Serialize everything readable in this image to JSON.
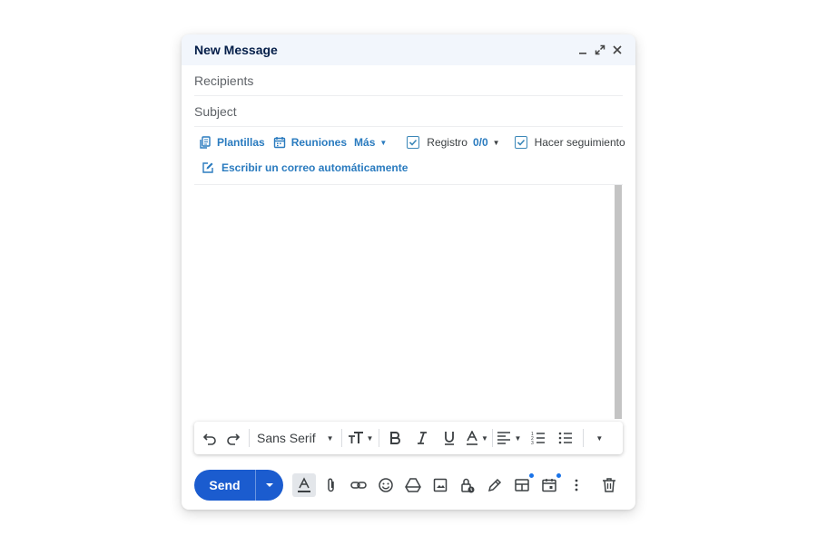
{
  "window": {
    "title": "New Message",
    "controls": [
      "minimize-icon",
      "expand-icon",
      "close-icon"
    ]
  },
  "fields": {
    "recipients_placeholder": "Recipients",
    "subject_placeholder": "Subject"
  },
  "extension": {
    "templates": "Plantillas",
    "meetings": "Reuniones",
    "more": "Más",
    "register": "Registro",
    "register_count": "0/0",
    "follow_up": "Hacer seguimiento",
    "auto_write": "Escribir un correo automáticamente"
  },
  "format_toolbar": {
    "font": "Sans Serif",
    "items": [
      "undo-icon",
      "redo-icon",
      "font-size-icon",
      "bold-icon",
      "italic-icon",
      "underline-icon",
      "text-color-icon",
      "align-icon",
      "numbered-list-icon",
      "bulleted-list-icon",
      "more-formatting-icon"
    ]
  },
  "bottom_bar": {
    "send_label": "Send",
    "icons": [
      "formatting-icon",
      "attach-icon",
      "link-icon",
      "emoji-icon",
      "drive-icon",
      "photo-icon",
      "confidential-icon",
      "signature-icon",
      "layouts-icon",
      "schedule-icon",
      "more-options-icon",
      "delete-icon"
    ]
  },
  "colors": {
    "send_button": "#1b5ccf",
    "header_bg": "#f2f6fc",
    "extension_accent": "#2a7bbf"
  }
}
